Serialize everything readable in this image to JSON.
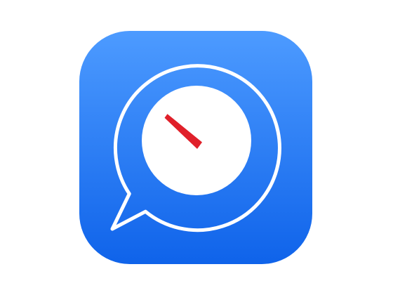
{
  "icon": {
    "name": "chat-timer-app-icon",
    "colors": {
      "background_top": "#4d9bff",
      "background_bottom": "#0f63ea",
      "outline": "#ffffff",
      "dial_face": "#ffffff",
      "needle": "#e0202a"
    }
  }
}
